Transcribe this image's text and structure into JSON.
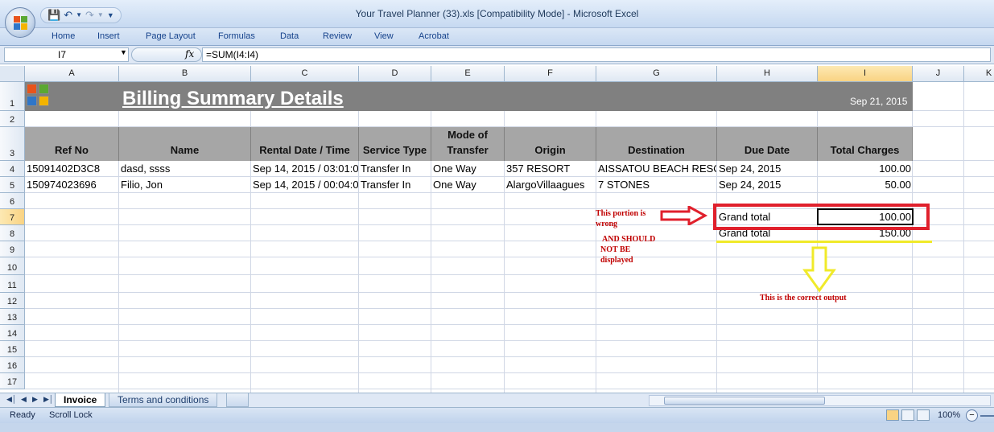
{
  "window": {
    "title": "Your Travel Planner (33).xls  [Compatibility Mode] - Microsoft Excel"
  },
  "ribbon": {
    "tabs": [
      "Home",
      "Insert",
      "Page Layout",
      "Formulas",
      "Data",
      "Review",
      "View",
      "Acrobat"
    ]
  },
  "formula_bar": {
    "name_box": "I7",
    "fx_label": "fx",
    "formula": "=SUM(I4:I4)"
  },
  "columns": [
    "A",
    "B",
    "C",
    "D",
    "E",
    "F",
    "G",
    "H",
    "I",
    "J",
    "K"
  ],
  "rows": [
    "1",
    "2",
    "3",
    "4",
    "5",
    "6",
    "7",
    "8",
    "9",
    "10",
    "11",
    "12",
    "13",
    "14",
    "15",
    "16",
    "17"
  ],
  "sheet": {
    "title": "Billing Summary Details",
    "date": "Sep 21, 2015",
    "headers": [
      "Ref No",
      "Name",
      "Rental Date / Time",
      "Service Type",
      "Mode of Transfer",
      "Origin",
      "Destination",
      "Due Date",
      "Total Charges"
    ],
    "data": [
      [
        "15091402D3C8",
        "dasd, ssss",
        "Sep 14, 2015 / 03:01:0",
        "Transfer In",
        "One Way",
        "357 RESORT",
        "AISSATOU BEACH RESOR",
        "Sep 24, 2015",
        "100.00"
      ],
      [
        "150974023696",
        "Filio, Jon",
        "Sep 14, 2015 / 00:04:0",
        "Transfer In",
        "One Way",
        "AlargoVillaagues",
        "7 STONES",
        "Sep 24, 2015",
        "50.00"
      ]
    ],
    "grand_total_wrong": {
      "label": "Grand total",
      "value": "100.00"
    },
    "grand_total_correct": {
      "label": "Grand total",
      "value": "150.00"
    }
  },
  "annotations": {
    "wrong_1": "This portion is",
    "wrong_2": "wrong",
    "should_1": "AND SHOULD",
    "should_2": "NOT BE",
    "should_3": "displayed",
    "correct": "This is the correct output"
  },
  "sheet_tabs": [
    "Invoice",
    "Terms and conditions"
  ],
  "status_bar": {
    "ready": "Ready",
    "scroll_lock": "Scroll Lock",
    "zoom": "100%"
  },
  "colors": {
    "annotation_red": "#e0202c",
    "annotation_yellow": "#f0ea2a",
    "banner_gray": "#808080",
    "header_gray": "#a6a6a6"
  }
}
